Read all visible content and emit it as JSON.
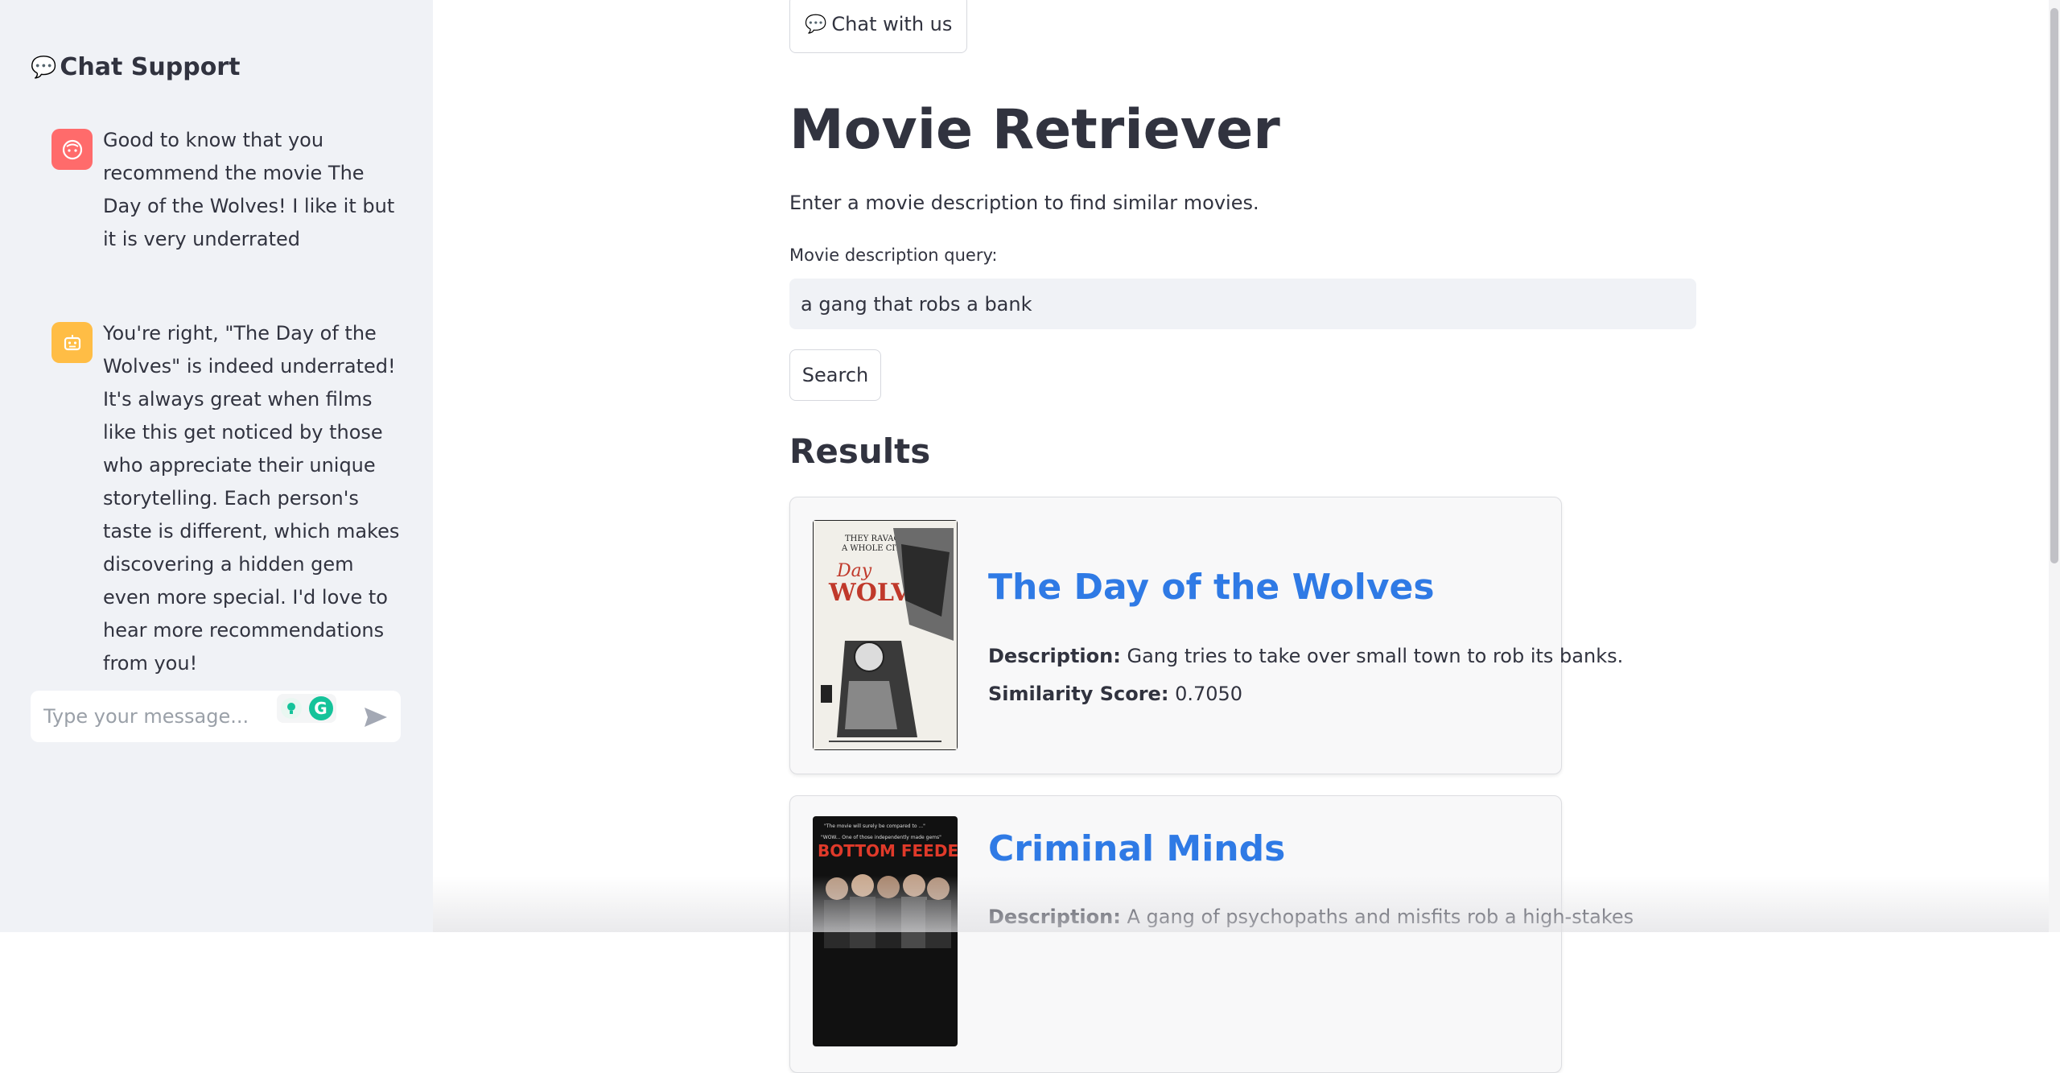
{
  "sidebar": {
    "title": "Chat Support",
    "title_icon": "speech-bubble-icon",
    "messages": [
      {
        "role": "user",
        "avatar_icon": "user-face-icon",
        "text": "Good to know that you recommend the movie The Day of the Wolves! I like it but it is very underrated"
      },
      {
        "role": "assistant",
        "avatar_icon": "robot-icon",
        "text": "You're right, \"The Day of the Wolves\" is indeed underrated! It's always great when films like this get noticed by those who appreciate their unique storytelling. Each person's taste is different, which makes discovering a hidden gem even more special. I'd love to hear more recommendations from you!"
      }
    ],
    "chat_input": {
      "placeholder": "Type your message...",
      "value": ""
    }
  },
  "header": {
    "chat_button_label": "Chat with us",
    "chat_button_icon": "speech-bubble-icon"
  },
  "main": {
    "title": "Movie Retriever",
    "subtitle": "Enter a movie description to find similar movies.",
    "query_label": "Movie description query:",
    "query_value": "a gang that robs a bank",
    "search_button_label": "Search",
    "results_heading": "Results",
    "description_label": "Description:",
    "score_label": "Similarity Score:",
    "results": [
      {
        "title": "The Day of the Wolves",
        "description": "Gang tries to take over small town to rob its banks.",
        "score": "0.7050",
        "poster_icon": "movie-poster-day-of-the-wolves"
      },
      {
        "title": "Criminal Minds",
        "description": "A gang of psychopaths and misfits rob a high-stakes",
        "score": "",
        "poster_icon": "movie-poster-bottom-feeders"
      }
    ]
  },
  "colors": {
    "sidebar_bg": "#f0f2f6",
    "link": "#2f7ae5",
    "user_avatar": "#ff6b6b",
    "bot_avatar": "#ffbd45"
  }
}
